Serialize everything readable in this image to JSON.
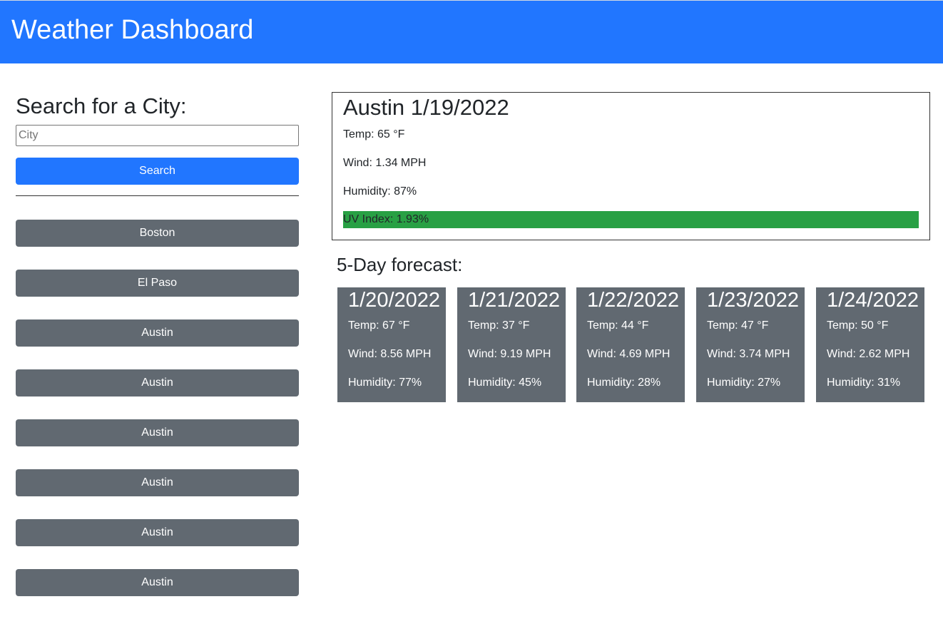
{
  "header": {
    "title": "Weather Dashboard"
  },
  "search": {
    "title": "Search for a City:",
    "placeholder": "City",
    "button_label": "Search"
  },
  "history": [
    "Boston",
    "El Paso",
    "Austin",
    "Austin",
    "Austin",
    "Austin",
    "Austin",
    "Austin"
  ],
  "current": {
    "title": "Austin 1/19/2022",
    "temp": "Temp: 65 °F",
    "wind": "Wind: 1.34 MPH",
    "humidity": "Humidity: 87%",
    "uv": "UV Index: 1.93%",
    "uv_color": "#28a044"
  },
  "forecast": {
    "title": "5-Day forecast:",
    "days": [
      {
        "date": "1/20/2022",
        "temp": "Temp: 67 °F",
        "wind": "Wind: 8.56 MPH",
        "humidity": "Humidity: 77%"
      },
      {
        "date": "1/21/2022",
        "temp": "Temp: 37 °F",
        "wind": "Wind: 9.19 MPH",
        "humidity": "Humidity: 45%"
      },
      {
        "date": "1/22/2022",
        "temp": "Temp: 44 °F",
        "wind": "Wind: 4.69 MPH",
        "humidity": "Humidity: 28%"
      },
      {
        "date": "1/23/2022",
        "temp": "Temp: 47 °F",
        "wind": "Wind: 3.74 MPH",
        "humidity": "Humidity: 27%"
      },
      {
        "date": "1/24/2022",
        "temp": "Temp: 50 °F",
        "wind": "Wind: 2.62 MPH",
        "humidity": "Humidity: 31%"
      }
    ]
  },
  "colors": {
    "primary": "#2176ff",
    "secondary": "#616971",
    "uv_good": "#28a044"
  }
}
